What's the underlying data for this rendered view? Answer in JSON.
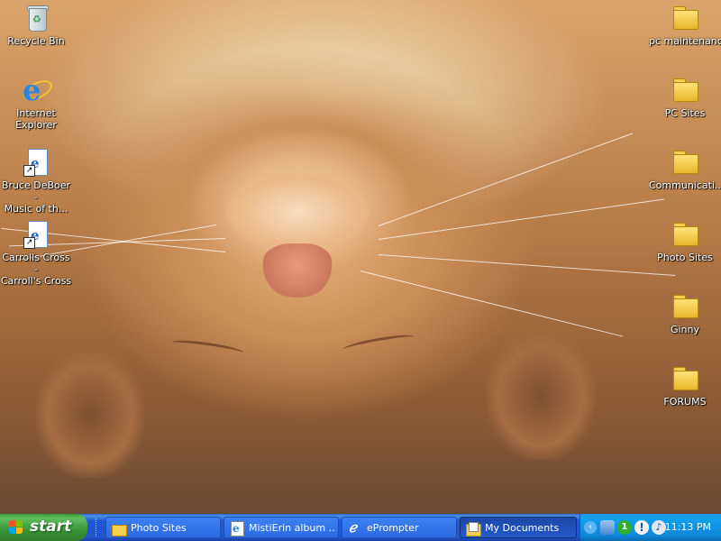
{
  "desktop": {
    "left_icons": [
      {
        "label": "Recycle Bin",
        "icon": "recycle-bin-icon"
      },
      {
        "label": "Internet\nExplorer",
        "icon": "internet-explorer-icon"
      },
      {
        "label": "Bruce DeBoer -\nMusic of th...",
        "icon": "document-shortcut-icon"
      },
      {
        "label": "Carrolls Cross -\nCarroll's Cross",
        "icon": "document-shortcut-icon"
      }
    ],
    "right_icons": [
      {
        "label": "pc maintenance",
        "icon": "folder-icon"
      },
      {
        "label": "PC Sites",
        "icon": "folder-icon"
      },
      {
        "label": "Communicati...",
        "icon": "folder-icon"
      },
      {
        "label": "Photo Sites",
        "icon": "folder-icon"
      },
      {
        "label": "Ginny",
        "icon": "folder-icon"
      },
      {
        "label": "FORUMS",
        "icon": "folder-icon"
      }
    ]
  },
  "taskbar": {
    "start_label": "start",
    "buttons": [
      {
        "label": "Photo Sites",
        "icon": "folder-icon",
        "active": false
      },
      {
        "label": "MistiErin album ...",
        "icon": "internet-explorer-icon",
        "active": false
      },
      {
        "label": "ePrompter",
        "icon": "eprompter-icon",
        "active": false
      },
      {
        "label": "My Documents",
        "icon": "my-documents-icon",
        "active": true
      }
    ],
    "tray": {
      "icons": [
        "network-icon",
        "notification-count-icon",
        "security-alert-icon",
        "speaker-icon"
      ],
      "notification_count": "1",
      "clock": "11:13 PM"
    }
  },
  "colors": {
    "taskbar_blue": "#2157d7",
    "start_green": "#379437",
    "tray_blue": "#0e86d8",
    "folder_yellow": "#f6cf4e"
  }
}
